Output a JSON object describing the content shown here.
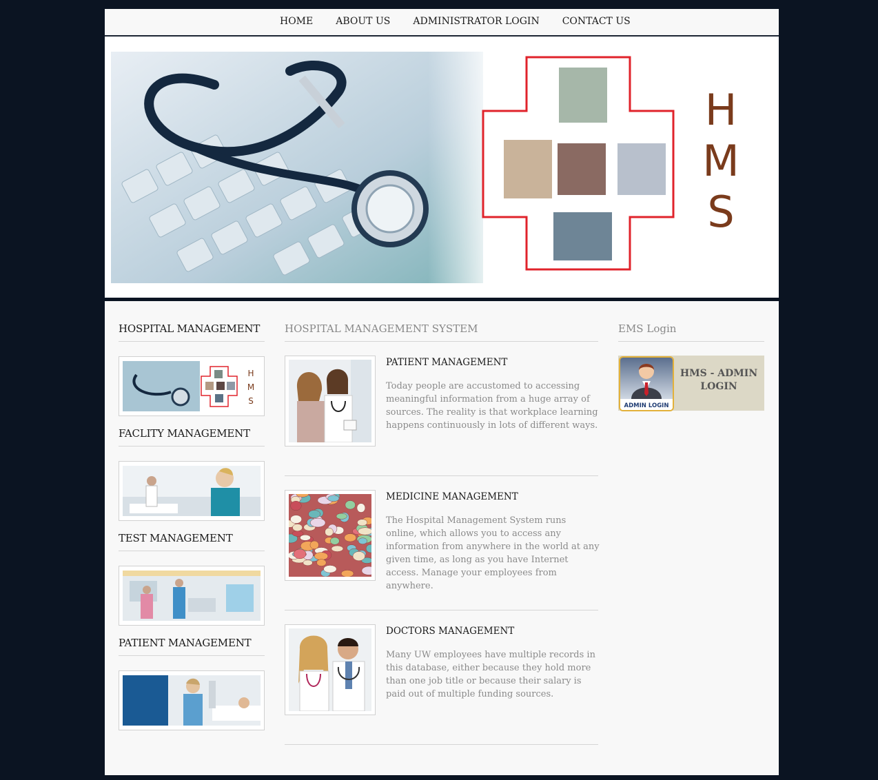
{
  "nav": {
    "items": [
      "HOME",
      "ABOUT US",
      "ADMINISTRATOR LOGIN",
      "CONTACT US"
    ]
  },
  "banner": {
    "letters": [
      "H",
      "M",
      "S"
    ]
  },
  "left": {
    "items": [
      {
        "title": "HOSPITAL MANAGEMENT"
      },
      {
        "title": "FACLITY MANAGEMENT"
      },
      {
        "title": "TEST MANAGEMENT"
      },
      {
        "title": "PATIENT MANAGEMENT"
      }
    ]
  },
  "middle": {
    "heading": "HOSPITAL MANAGEMENT SYSTEM",
    "articles": [
      {
        "title": "PATIENT MANAGEMENT",
        "text": "Today people are accustomed to accessing meaningful information from a huge array of sources. The reality is that workplace learning happens continuously in lots of different ways."
      },
      {
        "title": "MEDICINE MANAGEMENT",
        "text": "The Hospital Management System runs online, which allows you to access any information from anywhere in the world at any given time, as long as you have Internet access. Manage your employees from anywhere."
      },
      {
        "title": "DOCTORS MANAGEMENT",
        "text": "Many UW employees have multiple records in this database, either because they hold more than one job title or because their salary is paid out of multiple funding sources."
      }
    ]
  },
  "right": {
    "heading": "EMS Login",
    "admin_label": "HMS - ADMIN LOGIN",
    "icon_caption": "ADMIN LOGIN"
  },
  "colors": {
    "background": "#0b1422",
    "page": "#f8f8f8",
    "admin_box": "#dcd8c6",
    "hms_letters": "#7a3b1c",
    "red_cross": "#e0232b"
  }
}
